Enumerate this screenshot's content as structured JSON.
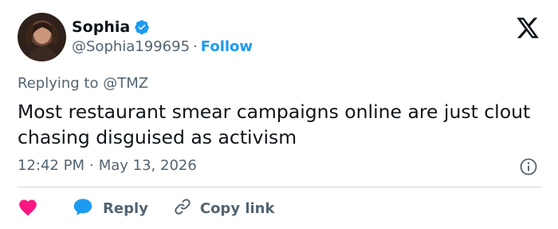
{
  "author": {
    "display_name": "Sophia",
    "handle": "@Sophia199695",
    "separator": "·",
    "follow_label": "Follow"
  },
  "reply_context": {
    "prefix": "Replying to",
    "target": "@TMZ"
  },
  "tweet": {
    "text": "Most restaurant smear campaigns online are just clout chasing disguised as activism",
    "time": "12:42 PM",
    "meta_separator": "·",
    "date": "May 13, 2026"
  },
  "actions": {
    "reply_label": "Reply",
    "copy_link_label": "Copy link"
  },
  "colors": {
    "accent": "#1d9bf0",
    "like": "#f91880",
    "text_primary": "#0f1419",
    "text_secondary": "#536471",
    "divider": "#cfd9de"
  },
  "icons": [
    "verified-badge-icon",
    "x-logo-icon",
    "info-icon",
    "heart-icon",
    "reply-bubble-icon",
    "link-icon"
  ]
}
